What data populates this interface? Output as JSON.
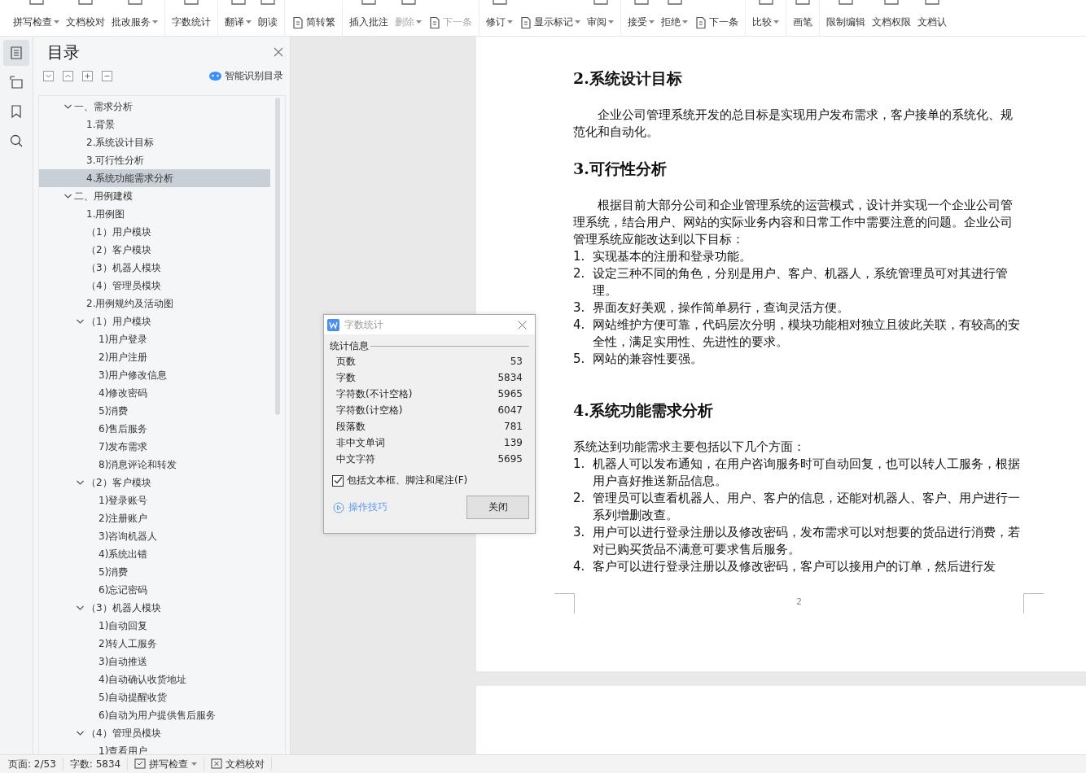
{
  "toolbar": {
    "groups": [
      {
        "items": [
          {
            "label": "拼写检查",
            "dropdown": true,
            "disabled": false,
            "kind": "stacked"
          },
          {
            "label": "文档校对",
            "dropdown": false,
            "disabled": false,
            "kind": "stacked"
          },
          {
            "label": "批改服务",
            "dropdown": true,
            "disabled": false,
            "kind": "stacked"
          }
        ]
      },
      {
        "items": [
          {
            "label": "字数统计",
            "dropdown": false,
            "disabled": false,
            "kind": "stacked"
          }
        ]
      },
      {
        "items": [
          {
            "label": "翻译",
            "dropdown": true,
            "disabled": false,
            "kind": "stacked"
          },
          {
            "label": "朗读",
            "dropdown": false,
            "disabled": false,
            "kind": "stacked"
          }
        ]
      },
      {
        "items": [
          {
            "label": "简转繁",
            "dropdown": false,
            "disabled": false,
            "kind": "inline"
          }
        ]
      },
      {
        "items": [
          {
            "label": "插入批注",
            "dropdown": false,
            "disabled": false,
            "kind": "stacked"
          },
          {
            "label": "删除",
            "dropdown": true,
            "disabled": true,
            "kind": "stacked"
          },
          {
            "label": "下一条",
            "dropdown": false,
            "disabled": true,
            "kind": "inline"
          }
        ]
      },
      {
        "items": [
          {
            "label": "修订",
            "dropdown": true,
            "disabled": false,
            "kind": "stacked"
          },
          {
            "label": "显示标记",
            "dropdown": true,
            "disabled": false,
            "kind": "inline"
          },
          {
            "label": "审阅",
            "dropdown": true,
            "disabled": false,
            "kind": "stacked"
          }
        ]
      },
      {
        "items": [
          {
            "label": "接受",
            "dropdown": true,
            "disabled": false,
            "kind": "stacked"
          },
          {
            "label": "拒绝",
            "dropdown": true,
            "disabled": false,
            "kind": "stacked"
          },
          {
            "label": "下一条",
            "dropdown": false,
            "disabled": false,
            "kind": "inline"
          }
        ]
      },
      {
        "items": [
          {
            "label": "比较",
            "dropdown": true,
            "disabled": false,
            "kind": "stacked"
          }
        ]
      },
      {
        "items": [
          {
            "label": "画笔",
            "dropdown": false,
            "disabled": false,
            "kind": "stacked"
          }
        ]
      },
      {
        "items": [
          {
            "label": "限制编辑",
            "dropdown": false,
            "disabled": false,
            "kind": "stacked"
          },
          {
            "label": "文档权限",
            "dropdown": false,
            "disabled": false,
            "kind": "stacked"
          },
          {
            "label": "文档认",
            "dropdown": false,
            "disabled": false,
            "kind": "stacked"
          }
        ]
      }
    ]
  },
  "rail": [
    {
      "kind": "outline",
      "selected": true
    },
    {
      "kind": "tree",
      "selected": false
    },
    {
      "kind": "bookmark",
      "selected": false
    },
    {
      "kind": "search",
      "selected": false
    }
  ],
  "toc": {
    "title": "目录",
    "smart_button": "智能识别目录",
    "items": [
      {
        "label": "一、需求分析",
        "expanded": true,
        "selected": false,
        "children": [
          {
            "label": "1.背景",
            "selected": false
          },
          {
            "label": "2.系统设计目标",
            "selected": false
          },
          {
            "label": "3.可行性分析",
            "selected": false
          },
          {
            "label": "4.系统功能需求分析",
            "selected": true
          }
        ]
      },
      {
        "label": "二、用例建模",
        "expanded": true,
        "selected": false,
        "children": [
          {
            "label": "1.用例图",
            "selected": false
          },
          {
            "label": "（1）用户模块",
            "selected": false
          },
          {
            "label": "（2）客户模块",
            "selected": false
          },
          {
            "label": "（3）机器人模块",
            "selected": false
          },
          {
            "label": "（4）管理员模块",
            "selected": false
          },
          {
            "label": "2.用例规约及活动图",
            "selected": false
          },
          {
            "label": "（1）用户模块",
            "expanded": true,
            "selected": false,
            "children": [
              {
                "label": "1)用户登录",
                "selected": false
              },
              {
                "label": "2)用户注册",
                "selected": false
              },
              {
                "label": "3)用户修改信息",
                "selected": false
              },
              {
                "label": "4)修改密码",
                "selected": false
              },
              {
                "label": "5)消费",
                "selected": false
              },
              {
                "label": "6)售后服务",
                "selected": false
              },
              {
                "label": "7)发布需求",
                "selected": false
              },
              {
                "label": "8)消息评论和转发",
                "selected": false
              }
            ]
          },
          {
            "label": "（2）客户模块",
            "expanded": true,
            "selected": false,
            "children": [
              {
                "label": "1)登录账号",
                "selected": false
              },
              {
                "label": "2)注册账户",
                "selected": false
              },
              {
                "label": "3)咨询机器人",
                "selected": false
              },
              {
                "label": "4)系统出错",
                "selected": false
              },
              {
                "label": "5)消费",
                "selected": false
              },
              {
                "label": "6)忘记密码",
                "selected": false
              }
            ]
          },
          {
            "label": "（3）机器人模块",
            "expanded": true,
            "selected": false,
            "children": [
              {
                "label": "1)自动回复",
                "selected": false
              },
              {
                "label": "2)转人工服务",
                "selected": false
              },
              {
                "label": "3)自动推送",
                "selected": false
              },
              {
                "label": "4)自动确认收货地址",
                "selected": false
              },
              {
                "label": "5)自动提醒收货",
                "selected": false
              },
              {
                "label": "6)自动为用户提供售后服务",
                "selected": false
              }
            ]
          },
          {
            "label": "（4）管理员模块",
            "expanded": true,
            "selected": false,
            "children": [
              {
                "label": "1)查看用户",
                "selected": false
              }
            ]
          }
        ]
      }
    ]
  },
  "document": {
    "blocks": [
      {
        "kind": "heading",
        "text": "2.系统设计目标"
      },
      {
        "kind": "paragraph",
        "indent": true,
        "text": "企业公司管理系统开发的总目标是实现用户发布需求，客户接单的系统化、规范化和自动化。"
      },
      {
        "kind": "heading",
        "text": "3.可行性分析"
      },
      {
        "kind": "paragraph",
        "indent": true,
        "text": "根据目前大部分公司和企业管理系统的运营模式，设计并实现一个企业公司管理系统，结合用户、网站的实际业务内容和日常工作中需要注意的问题。企业公司管理系统应能改达到以下目标："
      },
      {
        "kind": "list",
        "items": [
          {
            "num": "1.",
            "text": "实现基本的注册和登录功能。"
          },
          {
            "num": "2.",
            "text": "设定三种不同的角色，分别是用户、客户、机器人，系统管理员可对其进行管理。"
          },
          {
            "num": "3.",
            "text": "界面友好美观，操作简单易行，查询灵活方便。"
          },
          {
            "num": "4.",
            "text": "网站维护方便可靠，代码层次分明，模块功能相对独立且彼此关联，有较高的安全性，满足实用性、先进性的要求。"
          },
          {
            "num": "5.",
            "text": "网站的兼容性要强。"
          }
        ]
      },
      {
        "kind": "heading",
        "text": "4.系统功能需求分析"
      },
      {
        "kind": "paragraph",
        "indent": false,
        "text": "系统达到功能需求主要包括以下几个方面："
      },
      {
        "kind": "list",
        "items": [
          {
            "num": "1.",
            "text": "机器人可以发布通知，在用户咨询服务时可自动回复，也可以转人工服务，根据用户喜好推送新品信息。"
          },
          {
            "num": "2.",
            "text": "管理员可以查看机器人、用户、客户的信息，还能对机器人、客户、用户进行一系列增删改查。"
          },
          {
            "num": "3.",
            "text": "用户可以进行登录注册以及修改密码，发布需求可以对想要的货品进行消费，若对已购买货品不满意可要求售后服务。"
          },
          {
            "num": "4.",
            "text": "客户可以进行登录注册以及修改密码，客户可以接用户的订单，然后进行发"
          }
        ]
      }
    ],
    "page_number": "2"
  },
  "dialog": {
    "title": "字数统计",
    "section": "统计信息",
    "stats": [
      {
        "label": "页数",
        "value": "53"
      },
      {
        "label": "字数",
        "value": "5834"
      },
      {
        "label": "字符数(不计空格)",
        "value": "5965"
      },
      {
        "label": "字符数(计空格)",
        "value": "6047"
      },
      {
        "label": "段落数",
        "value": "781"
      },
      {
        "label": "非中文单词",
        "value": "139"
      },
      {
        "label": "中文字符",
        "value": "5695"
      }
    ],
    "checkbox": {
      "label": "包括文本框、脚注和尾注(F)",
      "checked": true
    },
    "tips_link": "操作技巧",
    "close_button": "关闭"
  },
  "status_bar": {
    "page": "页面: 2/53",
    "words": "字数: 5834",
    "spell_check": "拼写检查",
    "proofread": "文档校对"
  }
}
